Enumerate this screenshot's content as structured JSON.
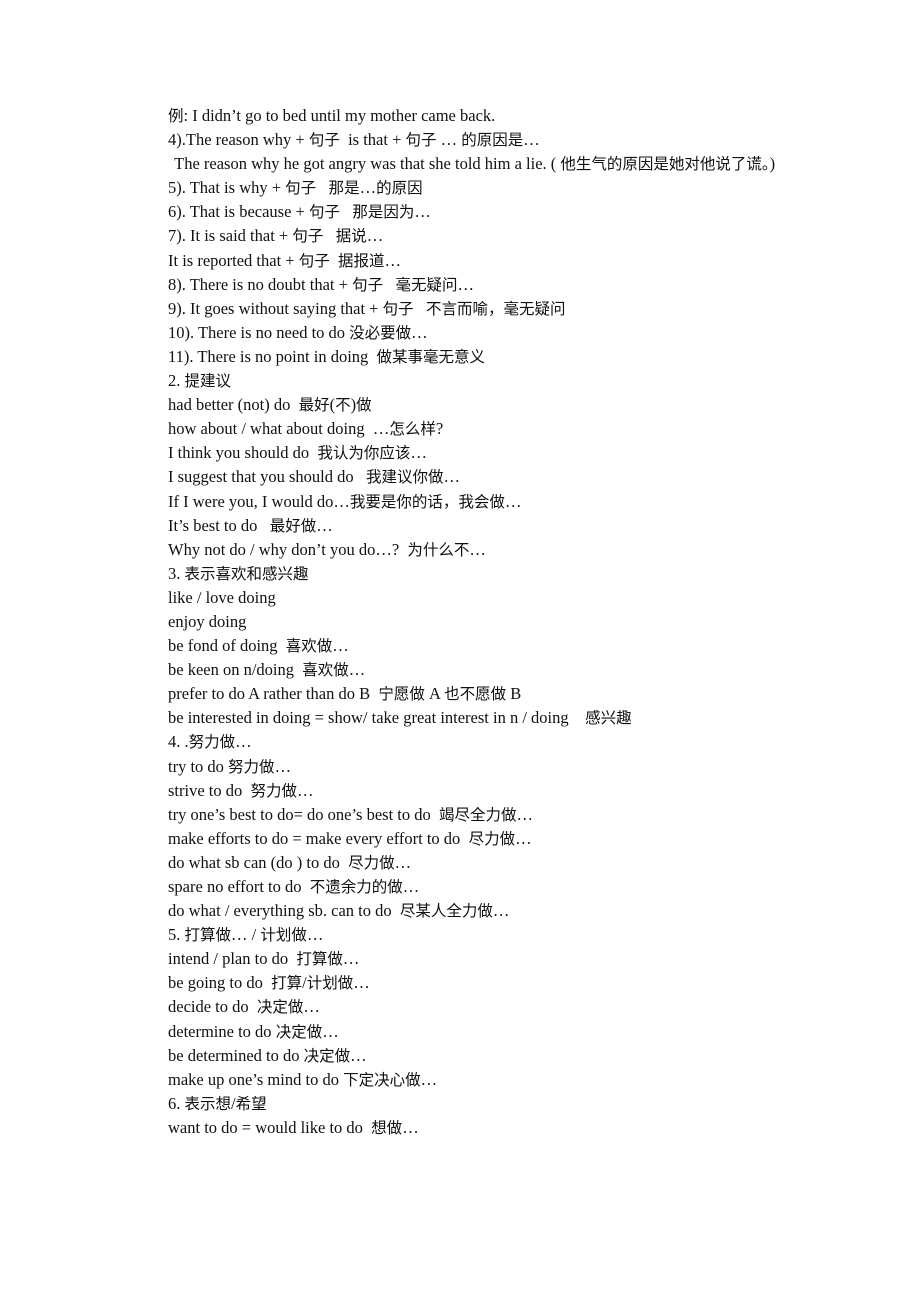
{
  "document": {
    "lines": [
      {
        "text": "例: I didn’t go to bed until my mother came back."
      },
      {
        "text": "4).The reason why + 句子  is that + 句子 … 的原因是…"
      },
      {
        "text": " The reason why he got angry was that she told him a lie. ( 他生气的原因是她对他说了谎。)",
        "wrap": true
      },
      {
        "text": "5). That is why + 句子   那是…的原因"
      },
      {
        "text": "6). That is because + 句子   那是因为…"
      },
      {
        "text": "7). It is said that + 句子   据说…"
      },
      {
        "text": "It is reported that + 句子  据报道…"
      },
      {
        "text": "8). There is no doubt that + 句子   毫无疑问…"
      },
      {
        "text": "9). It goes without saying that + 句子   不言而喻，毫无疑问"
      },
      {
        "text": "10). There is no need to do 没必要做…"
      },
      {
        "text": "11). There is no point in doing  做某事毫无意义"
      },
      {
        "text": "2. 提建议"
      },
      {
        "text": "had better (not) do  最好(不)做"
      },
      {
        "text": "how about / what about doing  …怎么样?"
      },
      {
        "text": "I think you should do  我认为你应该…"
      },
      {
        "text": "I suggest that you should do   我建议你做…"
      },
      {
        "text": "If I were you, I would do…我要是你的话，我会做…"
      },
      {
        "text": "It’s best to do   最好做…"
      },
      {
        "text": "Why not do / why don’t you do…?  为什么不…"
      },
      {
        "text": "3. 表示喜欢和感兴趣"
      },
      {
        "text": "like / love doing"
      },
      {
        "text": "enjoy doing"
      },
      {
        "text": "be fond of doing  喜欢做…"
      },
      {
        "text": "be keen on n/doing  喜欢做…"
      },
      {
        "text": "prefer to do A rather than do B  宁愿做 A 也不愿做 B"
      },
      {
        "text": "be interested in doing = show/ take great interest in n / doing    感兴趣"
      },
      {
        "text": "4. .努力做…"
      },
      {
        "text": "try to do 努力做…"
      },
      {
        "text": "strive to do  努力做…"
      },
      {
        "text": "try one’s best to do= do one’s best to do  竭尽全力做…"
      },
      {
        "text": "make efforts to do = make every effort to do  尽力做…"
      },
      {
        "text": "do what sb can (do ) to do  尽力做…"
      },
      {
        "text": "spare no effort to do  不遗余力的做…"
      },
      {
        "text": "do what / everything sb. can to do  尽某人全力做…"
      },
      {
        "text": "5. 打算做… / 计划做…"
      },
      {
        "text": "intend / plan to do  打算做…"
      },
      {
        "text": "be going to do  打算/计划做…"
      },
      {
        "text": "decide to do  决定做…"
      },
      {
        "text": "determine to do 决定做…"
      },
      {
        "text": "be determined to do 决定做…"
      },
      {
        "text": "make up one’s mind to do 下定决心做…"
      },
      {
        "text": "6. 表示想/希望"
      },
      {
        "text": "want to do = would like to do  想做…"
      }
    ]
  }
}
